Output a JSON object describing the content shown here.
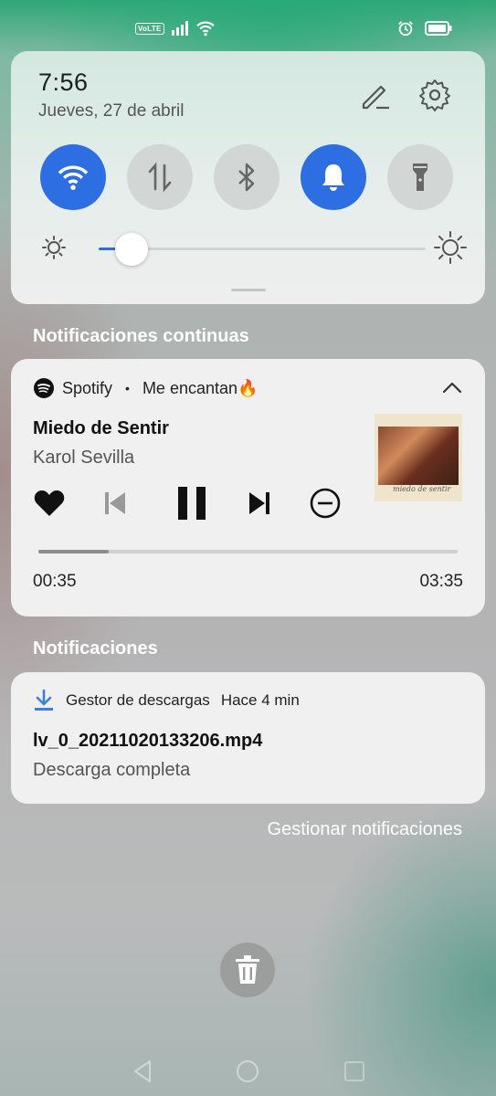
{
  "status_bar": {
    "volte_label": "VoLTE",
    "icons": [
      "volte-icon",
      "signal-icon",
      "wifi-icon",
      "alarm-icon",
      "battery-icon"
    ]
  },
  "quick_settings": {
    "time": "7:56",
    "date": "Jueves, 27 de abril",
    "toggles": [
      {
        "name": "wifi",
        "icon": "wifi-icon",
        "active": true
      },
      {
        "name": "mobile-data",
        "icon": "data-arrows-icon",
        "active": false
      },
      {
        "name": "bluetooth",
        "icon": "bluetooth-icon",
        "active": false
      },
      {
        "name": "sound",
        "icon": "bell-icon",
        "active": true
      },
      {
        "name": "flashlight",
        "icon": "flashlight-icon",
        "active": false
      }
    ],
    "brightness_level": 0.1,
    "accent_color": "#2d6fe3"
  },
  "ongoing_section_title": "Notificaciones continuas",
  "media_notification": {
    "app_name": "Spotify",
    "separator": "•",
    "context": "Me encantan🔥",
    "song_title": "Miedo de Sentir",
    "artist": "Karol Sevilla",
    "progress_fraction": 0.167,
    "current_time": "00:35",
    "total_time": "03:35",
    "controls": [
      "heart-icon",
      "previous-icon",
      "pause-icon",
      "next-icon",
      "remove-icon"
    ]
  },
  "notifications_section_title": "Notificaciones",
  "download_notification": {
    "app_name": "Gestor de descargas",
    "time_ago": "Hace 4 min",
    "file_name": "lv_0_20211020133206.mp4",
    "status": "Descarga completa"
  },
  "manage_link": "Gestionar notificaciones"
}
